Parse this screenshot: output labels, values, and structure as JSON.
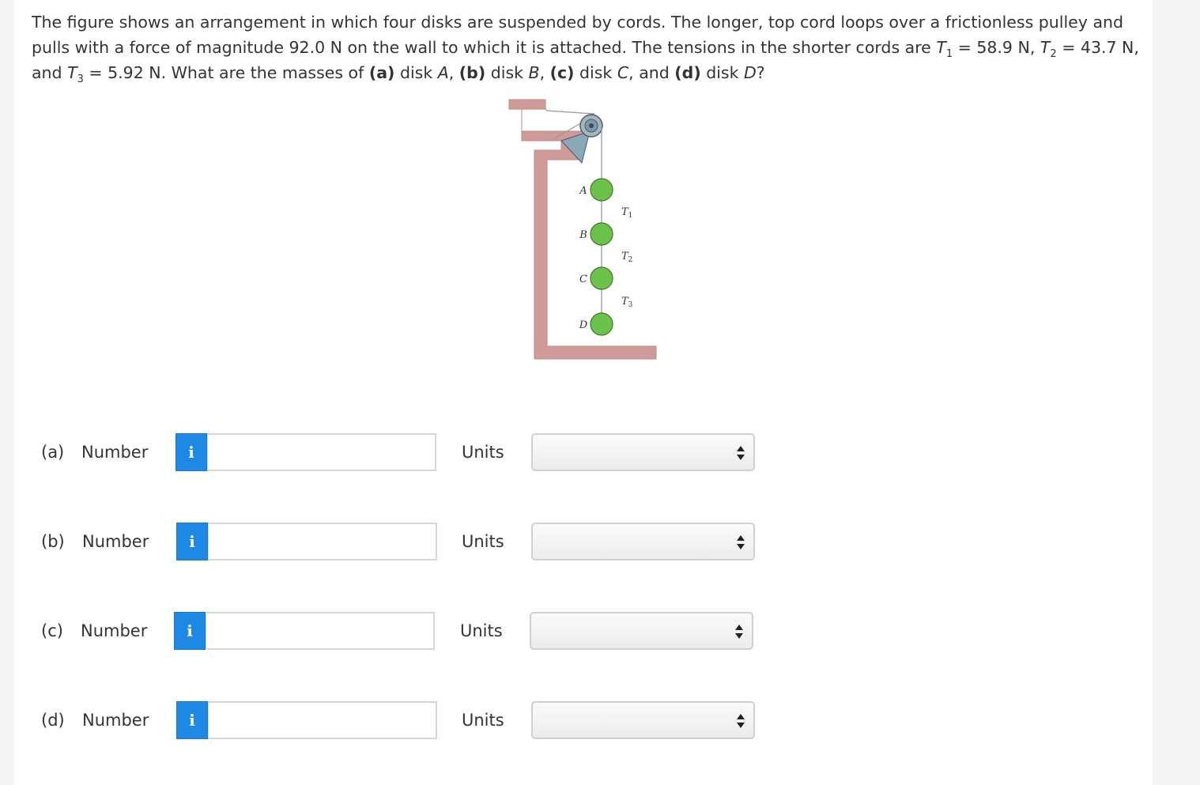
{
  "question": {
    "p1": "The figure shows an arrangement in which four disks are suspended by cords. The longer, top cord loops over a frictionless pulley and pulls with a force of magnitude 92.0 N on the wall to which it is attached. The tensions in the shorter cords are ",
    "t1_var": "T",
    "t1_sub": "1",
    "t1_val": " = 58.9 N, ",
    "t2_var": "T",
    "t2_sub": "2",
    "t2_val": " = 43.7 N, and ",
    "t3_var": "T",
    "t3_sub": "3",
    "t3_val": " = 5.92 N. What are the masses of ",
    "a_tag": "(a)",
    "a_text": " disk ",
    "a_var": "A",
    "sep1": ", ",
    "b_tag": "(b)",
    "b_text": " disk ",
    "b_var": "B",
    "sep2": ", ",
    "c_tag": "(c)",
    "c_text": " disk ",
    "c_var": "C",
    "sep3": ", and ",
    "d_tag": "(d)",
    "d_text": " disk ",
    "d_var": "D",
    "end": "?"
  },
  "figure": {
    "disk_labels": [
      "A",
      "B",
      "C",
      "D"
    ],
    "tension_labels": [
      {
        "var": "T",
        "sub": "1"
      },
      {
        "var": "T",
        "sub": "2"
      },
      {
        "var": "T",
        "sub": "3"
      }
    ],
    "colors": {
      "wall": "#cf9a98",
      "disk": "#6cc24a",
      "pulley": "#8aa9b8"
    }
  },
  "answers": [
    {
      "part": "(a)",
      "label": "Number",
      "info_icon": "i",
      "value": "",
      "units_label": "Units",
      "units_value": ""
    },
    {
      "part": "(b)",
      "label": "Number",
      "info_icon": "i",
      "value": "",
      "units_label": "Units",
      "units_value": ""
    },
    {
      "part": "(c)",
      "label": "Number",
      "info_icon": "i",
      "value": "",
      "units_label": "Units",
      "units_value": ""
    },
    {
      "part": "(d)",
      "label": "Number",
      "info_icon": "i",
      "value": "",
      "units_label": "Units",
      "units_value": ""
    }
  ]
}
